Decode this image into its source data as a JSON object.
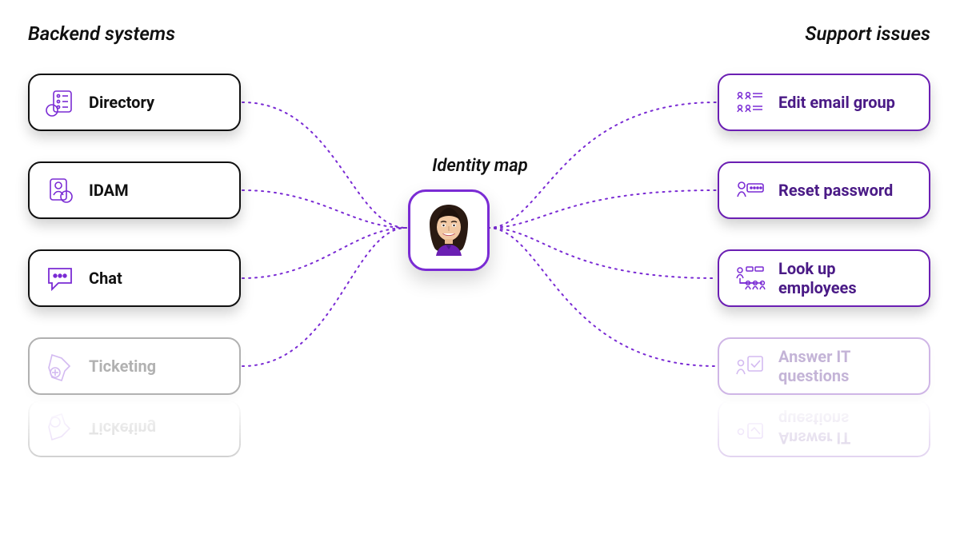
{
  "headings": {
    "left": "Backend systems",
    "right": "Support issues",
    "center": "Identity map"
  },
  "left_cards": [
    {
      "id": "directory",
      "label": "Directory",
      "icon": "directory-icon",
      "faded": false
    },
    {
      "id": "idam",
      "label": "IDAM",
      "icon": "idam-icon",
      "faded": false
    },
    {
      "id": "chat",
      "label": "Chat",
      "icon": "chat-icon",
      "faded": false
    },
    {
      "id": "ticketing",
      "label": "Ticketing",
      "icon": "ticketing-icon",
      "faded": true
    }
  ],
  "right_cards": [
    {
      "id": "edit-email-group",
      "label": "Edit email group",
      "icon": "group-icon",
      "faded": false
    },
    {
      "id": "reset-password",
      "label": "Reset password",
      "icon": "password-icon",
      "faded": false
    },
    {
      "id": "look-up-employees",
      "label": "Look up employees",
      "icon": "employees-icon",
      "faded": false
    },
    {
      "id": "answer-it-questions",
      "label": "Answer IT questions",
      "icon": "answer-icon",
      "faded": true
    }
  ],
  "colors": {
    "accent": "#7a2bd4",
    "accent_dark": "#4a1a86",
    "card_border_left": "#111111",
    "card_border_right": "#6b1fb3",
    "dotted": "#7a2bd4"
  }
}
